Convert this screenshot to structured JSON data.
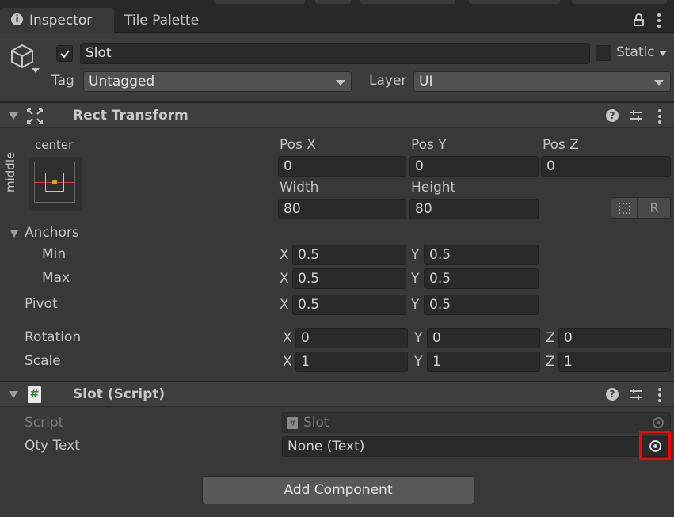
{
  "tabs": {
    "inspector": "Inspector",
    "tile_palette": "Tile Palette"
  },
  "object": {
    "name": "Slot",
    "active": true,
    "static_label": "Static",
    "tag_label": "Tag",
    "tag_value": "Untagged",
    "layer_label": "Layer",
    "layer_value": "UI"
  },
  "rect_transform": {
    "title": "Rect Transform",
    "anchor_h": "center",
    "anchor_v": "middle",
    "pos_x_label": "Pos X",
    "pos_x": "0",
    "pos_y_label": "Pos Y",
    "pos_y": "0",
    "pos_z_label": "Pos Z",
    "pos_z": "0",
    "width_label": "Width",
    "width": "80",
    "height_label": "Height",
    "height": "80",
    "raw_edit_label": "R",
    "anchors_label": "Anchors",
    "min_label": "Min",
    "min_x": "0.5",
    "min_y": "0.5",
    "max_label": "Max",
    "max_x": "0.5",
    "max_y": "0.5",
    "pivot_label": "Pivot",
    "pivot_x": "0.5",
    "pivot_y": "0.5",
    "rotation_label": "Rotation",
    "rot_x": "0",
    "rot_y": "0",
    "rot_z": "0",
    "scale_label": "Scale",
    "scale_x": "1",
    "scale_y": "1",
    "scale_z": "1",
    "axis_x": "X",
    "axis_y": "Y",
    "axis_z": "Z"
  },
  "script_component": {
    "title": "Slot (Script)",
    "script_label": "Script",
    "script_value": "Slot",
    "qty_label": "Qty Text",
    "qty_value": "None (Text)"
  },
  "add_component_label": "Add Component",
  "colors": {
    "highlight": "#ff0000",
    "anchor_dot": "#e0a020",
    "script_icon": "#5aa05a"
  }
}
